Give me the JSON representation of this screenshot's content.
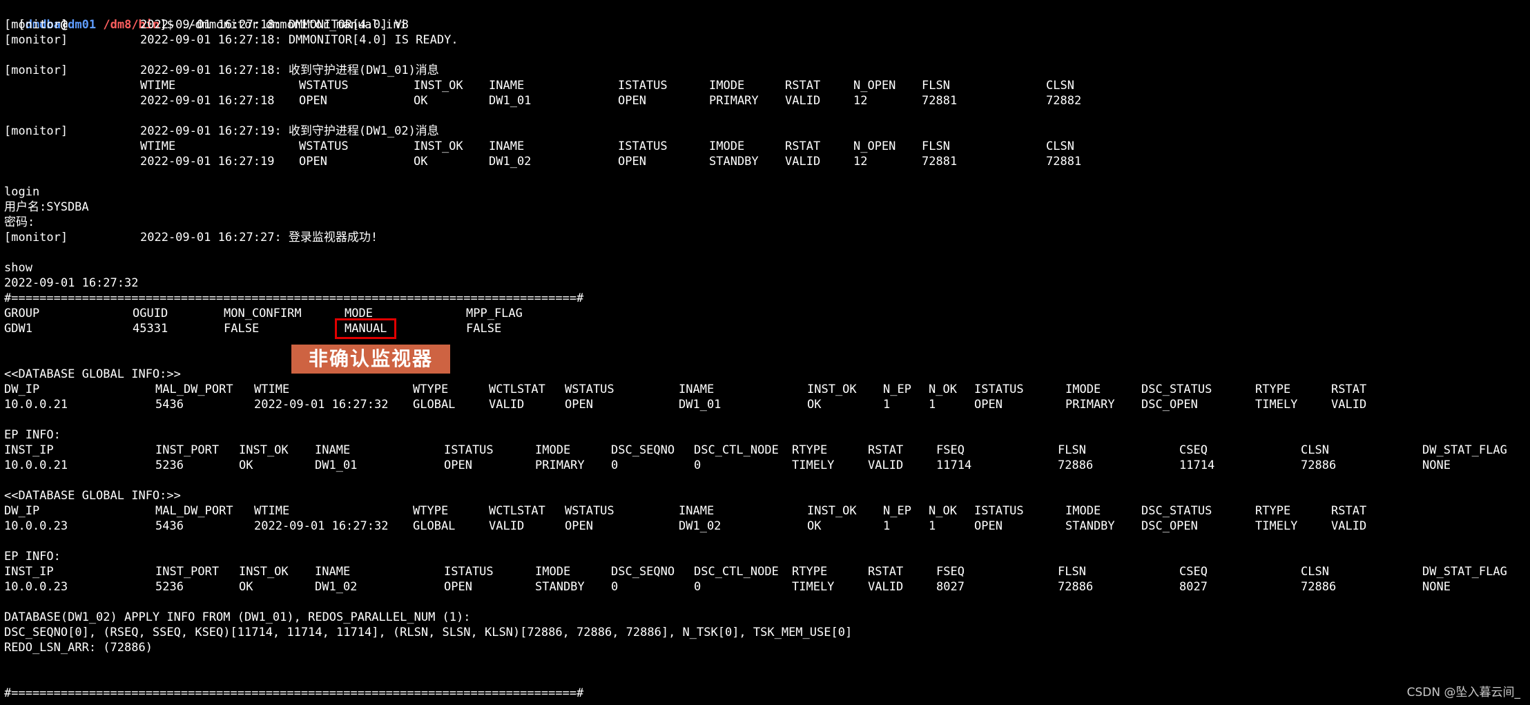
{
  "prompt": {
    "user": "dmdba",
    "at": "@",
    "host": "dm01",
    "path": "/dm8/bin",
    "suffix": "]$ ",
    "command": "./dmmonitor dmmonitor_manual.ini",
    "open": "["
  },
  "startup": {
    "tag": "[monitor]",
    "line1": "2022-09-01 16:27:18: DMMONITOR[4.0] V8",
    "line2": "2022-09-01 16:27:18: DMMONITOR[4.0] IS READY."
  },
  "watchers": {
    "headers": [
      "WTIME",
      "WSTATUS",
      "INST_OK",
      "INAME",
      "ISTATUS",
      "IMODE",
      "RSTAT",
      "N_OPEN",
      "FLSN",
      "CLSN"
    ],
    "items": [
      {
        "tag": "[monitor]",
        "msg": "2022-09-01 16:27:18: 收到守护进程(DW1_01)消息",
        "values": [
          "2022-09-01 16:27:18",
          "OPEN",
          "OK",
          "DW1_01",
          "OPEN",
          "PRIMARY",
          "VALID",
          "12",
          "72881",
          "72882"
        ]
      },
      {
        "tag": "[monitor]",
        "msg": "2022-09-01 16:27:19: 收到守护进程(DW1_02)消息",
        "values": [
          "2022-09-01 16:27:19",
          "OPEN",
          "OK",
          "DW1_02",
          "OPEN",
          "STANDBY",
          "VALID",
          "12",
          "72881",
          "72881"
        ]
      }
    ]
  },
  "login": {
    "cmd": "login",
    "user_line": "用户名:SYSDBA",
    "pwd_line": "密码:",
    "tag": "[monitor]",
    "msg": "2022-09-01 16:27:27: 登录监视器成功!"
  },
  "show": {
    "cmd": "show",
    "time": "2022-09-01 16:27:32",
    "separator": "#================================================================================#"
  },
  "group": {
    "headers": [
      "GROUP",
      "OGUID",
      "MON_CONFIRM",
      "MODE",
      "MPP_FLAG"
    ],
    "values": [
      "GDW1",
      "45331",
      "FALSE",
      "MANUAL",
      "FALSE"
    ]
  },
  "annotation": "非确认监视器",
  "db_blocks": {
    "title": "<<DATABASE GLOBAL INFO:>>",
    "ep_title": "EP INFO:",
    "g_headers": [
      "DW_IP",
      "MAL_DW_PORT",
      "WTIME",
      "WTYPE",
      "WCTLSTAT",
      "WSTATUS",
      "INAME",
      "INST_OK",
      "N_EP",
      "N_OK",
      "ISTATUS",
      "IMODE",
      "DSC_STATUS",
      "RTYPE",
      "RSTAT"
    ],
    "e_headers": [
      "INST_IP",
      "INST_PORT",
      "INST_OK",
      "INAME",
      "ISTATUS",
      "IMODE",
      "DSC_SEQNO",
      "DSC_CTL_NODE",
      "RTYPE",
      "RSTAT",
      "FSEQ",
      "FLSN",
      "CSEQ",
      "CLSN",
      "DW_STAT_FLAG"
    ],
    "items": [
      {
        "g": [
          "10.0.0.21",
          "5436",
          "2022-09-01 16:27:32",
          "GLOBAL",
          "VALID",
          "OPEN",
          "DW1_01",
          "OK",
          "1",
          "1",
          "OPEN",
          "PRIMARY",
          "DSC_OPEN",
          "TIMELY",
          "VALID"
        ],
        "e": [
          "10.0.0.21",
          "5236",
          "OK",
          "DW1_01",
          "OPEN",
          "PRIMARY",
          "0",
          "0",
          "TIMELY",
          "VALID",
          "11714",
          "72886",
          "11714",
          "72886",
          "NONE"
        ]
      },
      {
        "g": [
          "10.0.0.23",
          "5436",
          "2022-09-01 16:27:32",
          "GLOBAL",
          "VALID",
          "OPEN",
          "DW1_02",
          "OK",
          "1",
          "1",
          "OPEN",
          "STANDBY",
          "DSC_OPEN",
          "TIMELY",
          "VALID"
        ],
        "e": [
          "10.0.0.23",
          "5236",
          "OK",
          "DW1_02",
          "OPEN",
          "STANDBY",
          "0",
          "0",
          "TIMELY",
          "VALID",
          "8027",
          "72886",
          "8027",
          "72886",
          "NONE"
        ]
      }
    ]
  },
  "apply": {
    "line1": "DATABASE(DW1_02) APPLY INFO FROM (DW1_01), REDOS_PARALLEL_NUM (1):",
    "line2": "DSC_SEQNO[0], (RSEQ, SSEQ, KSEQ)[11714, 11714, 11714], (RLSN, SLSN, KLSN)[72886, 72886, 72886], N_TSK[0], TSK_MEM_USE[0]",
    "line3": "REDO_LSN_ARR: (72886)"
  },
  "watermark": "CSDN @坠入暮云间_"
}
